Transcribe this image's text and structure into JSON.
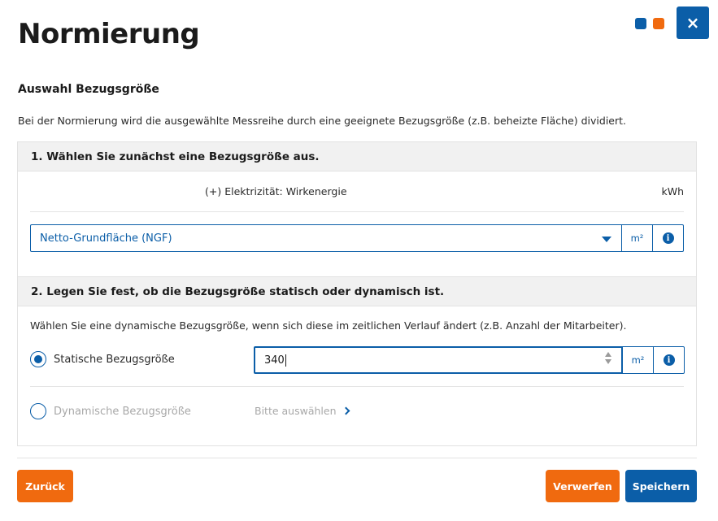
{
  "colors": {
    "primary": "#0b5ea8",
    "accent": "#f06a0f"
  },
  "dialog": {
    "title": "Normierung",
    "close_symbol": "×",
    "subtitle": "Auswahl Bezugsgröße",
    "description": "Bei der Normierung wird die ausgewählte Messreihe durch eine geeignete Bezugsgröße (z.B. beheizte Fläche) dividiert."
  },
  "step1": {
    "heading": "1. Wählen Sie zunächst eine Bezugsgröße aus.",
    "measure_label": "(+) Elektrizität: Wirkenergie",
    "measure_unit": "kWh",
    "reference_select_value": "Netto-Grundfläche (NGF)",
    "reference_unit": "m²",
    "info_symbol": "i"
  },
  "step2": {
    "heading": "2. Legen Sie fest, ob die Bezugsgröße statisch oder dynamisch ist.",
    "description": "Wählen Sie eine dynamische Bezugsgröße, wenn sich diese im zeitlichen Verlauf ändert (z.B. Anzahl der Mitarbeiter).",
    "static_label": "Statische Bezugsgröße",
    "static_value": "340",
    "static_unit": "m²",
    "info_symbol": "i",
    "dynamic_label": "Dynamische Bezugsgröße",
    "dynamic_link": "Bitte auswählen",
    "selected": "static"
  },
  "footer": {
    "back_label": "Zurück",
    "discard_label": "Verwerfen",
    "save_label": "Speichern"
  }
}
